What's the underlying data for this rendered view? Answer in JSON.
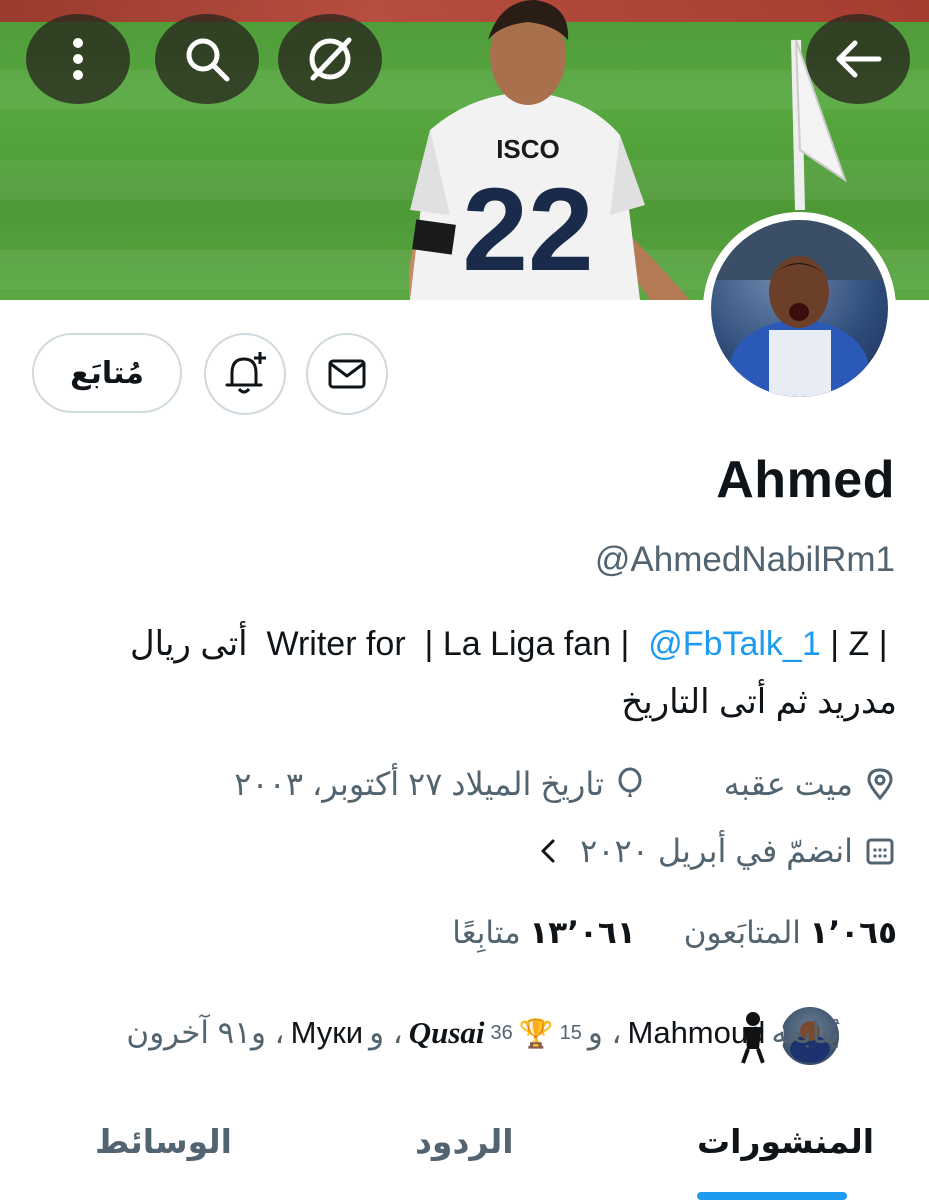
{
  "banner": {
    "jersey_name": "ISCO",
    "jersey_number": "22"
  },
  "top_buttons": {
    "more": "more-vertical-icon",
    "search": "search-icon",
    "grok": "grok-icon",
    "back": "arrow-left-icon"
  },
  "actions": {
    "follow_label": "مُتابَع",
    "notify_icon": "bell-plus-icon",
    "message_icon": "mail-icon"
  },
  "profile": {
    "name": "Ahmed",
    "handle": "@AhmedNabilRm1",
    "bio_line1_prefix": "| Z | ",
    "bio_line1_link": "@FbTalk_1",
    "bio_line1_middle": " Writer for  | La Liga fan | ",
    "bio_line1_suffix": "أتى ريال",
    "bio_line2": "مدريد ثم أتى التاريخ",
    "location": "ميت عقبه",
    "birthdate": "تاريخ الميلاد ٢٧ أكتوبر، ٢٠٠٣",
    "joined": "انضمّ في أبريل ٢٠٢٠"
  },
  "stats": {
    "followers_count": "١٬٠٦٥",
    "followers_label": "المتابَعون",
    "following_count": "١٣٬٠٦١",
    "following_label": "متابِعًا"
  },
  "followed_by": {
    "prefix": "يُتابعه",
    "name1": "Mahmoud",
    "sep1": "، و",
    "num15": "15",
    "num36": "36",
    "name2": "Qusai",
    "sep2": "، و",
    "name3": "Муки",
    "suffix": "، و٩١ آخرون"
  },
  "tabs": {
    "posts": "المنشورات",
    "replies": "الردود",
    "media": "الوسائط"
  },
  "colors": {
    "accent": "#1d9bf0",
    "text": "#0f1419",
    "muted": "#536471",
    "border": "#cfd9de"
  }
}
